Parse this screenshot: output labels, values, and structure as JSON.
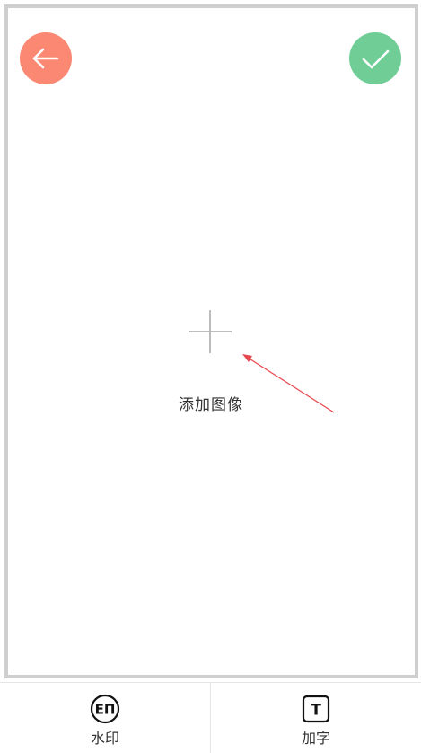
{
  "header": {
    "back_icon": "arrow-left-icon",
    "confirm_icon": "check-icon",
    "back_color": "#fa8872",
    "confirm_color": "#6fcd95"
  },
  "canvas": {
    "add_image_icon": "plus-icon",
    "add_image_label": "添加图像",
    "annotation_color": "#e8474f"
  },
  "toolbar": {
    "items": [
      {
        "label": "水印",
        "icon": "watermark-icon",
        "icon_text": "EП"
      },
      {
        "label": "加字",
        "icon": "add-text-icon",
        "icon_text": "T"
      }
    ]
  }
}
